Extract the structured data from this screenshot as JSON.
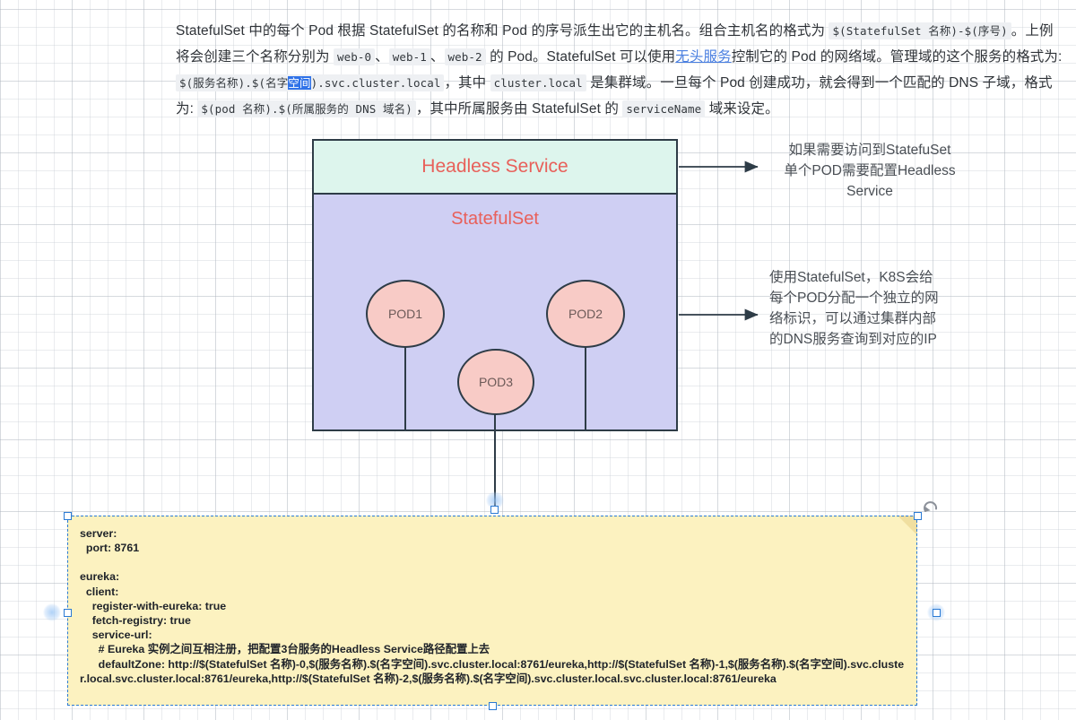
{
  "paragraph": {
    "line1_a": "StatefulSet 中的每个 Pod 根据 StatefulSet 的名称和 Pod 的序号派生出它的主机名。组合主机名的格式为 ",
    "code1": "$(StatefulSet 名称)-$(序号)",
    "line1_b": "。上例将会创建三个名称分别为 ",
    "code2": "web-0",
    "sep1": "、",
    "code3": "web-1",
    "sep2": "、",
    "code4": "web-2",
    "line1_c": " 的 Pod。StatefulSet 可以使用",
    "link1": "无头服务",
    "line1_d": "控制它的 Pod 的网络域。管理域的这个服务的格式为: ",
    "code5_pre": "$(服务名称).$(名字",
    "code5_sel": "空间",
    "code5_post": ").svc.cluster.local",
    "line2_a": "，其中 ",
    "code6": "cluster.local",
    "line2_b": " 是集群域。一旦每个 Pod 创建成功，就会得到一个匹配的 DNS 子域，格式为: ",
    "code7": "$(pod 名称).$(所属服务的 DNS 域名)",
    "line2_c": "，其中所属服务由 StatefulSet 的 ",
    "code8": "serviceName",
    "line2_d": " 域来设定。"
  },
  "diagram": {
    "headless_service_label": "Headless Service",
    "statefulset_label": "StatefulSet",
    "pods": [
      {
        "label": "POD1"
      },
      {
        "label": "POD2"
      },
      {
        "label": "POD3"
      }
    ],
    "annotations": [
      {
        "id": "headless-annotation",
        "lines": [
          "如果需要访问到StatefuSet",
          "单个POD需要配置Headless",
          "Service"
        ]
      },
      {
        "id": "network-identity-annotation",
        "lines": [
          "使用StatefulSet，K8S会给",
          "每个POD分配一个独立的网",
          "络标识，可以通过集群内部",
          "的DNS服务查询到对应的IP"
        ]
      }
    ]
  },
  "note": {
    "lines": [
      "server:",
      "  port: 8761",
      "",
      "eureka:",
      "  client:",
      "    register-with-eureka: true",
      "    fetch-registry: true",
      "    service-url:",
      "      # Eureka 实例之间互相注册，把配置3台服务的Headless Service路径配置上去",
      "      defaultZone: http://$(StatefulSet 名称)-0,$(服务名称).$(名字空间).svc.cluster.local:8761/eureka,http://$(StatefulSet 名称)-1,$(服务名称).$(名字空间).svc.cluster.local.svc.cluster.local:8761/eureka,http://$(StatefulSet 名称)-2,$(服务名称).$(名字空间).svc.cluster.local.svc.cluster.local:8761/eureka"
    ]
  },
  "colors": {
    "headless_fill": "#ddf5ed",
    "statefulset_fill": "#cfcff3",
    "pod_fill": "#f8cbc6",
    "stroke": "#2e3c47",
    "title_text": "#e8605a",
    "note_fill": "#fcf2c0",
    "selection": "#2a7ad4",
    "link": "#4a7fe0"
  }
}
